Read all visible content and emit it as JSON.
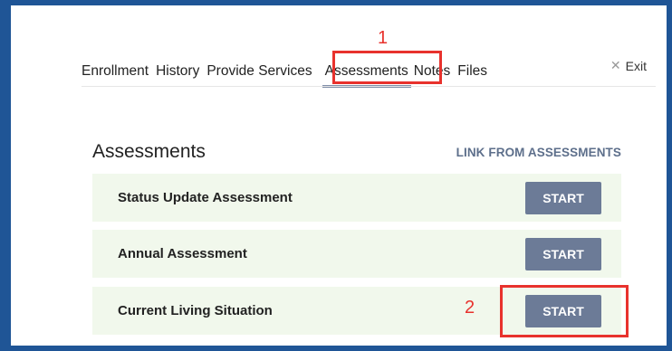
{
  "tabs": [
    {
      "label": "Enrollment"
    },
    {
      "label": "History"
    },
    {
      "label": "Provide Services"
    },
    {
      "label": "Assessments"
    },
    {
      "label": "Notes"
    },
    {
      "label": "Files"
    }
  ],
  "exit_label": "Exit",
  "annotations": {
    "one": "1",
    "two": "2"
  },
  "section": {
    "title": "Assessments",
    "link_label": "LINK FROM ASSESSMENTS"
  },
  "assessments": [
    {
      "label": "Status Update Assessment",
      "button": "START"
    },
    {
      "label": "Annual Assessment",
      "button": "START"
    },
    {
      "label": "Current Living Situation",
      "button": "START"
    }
  ],
  "colors": {
    "accent": "#e8322d",
    "button": "#6c7b97",
    "row_bg": "#f1f8ec",
    "frame": "#1f5596"
  }
}
